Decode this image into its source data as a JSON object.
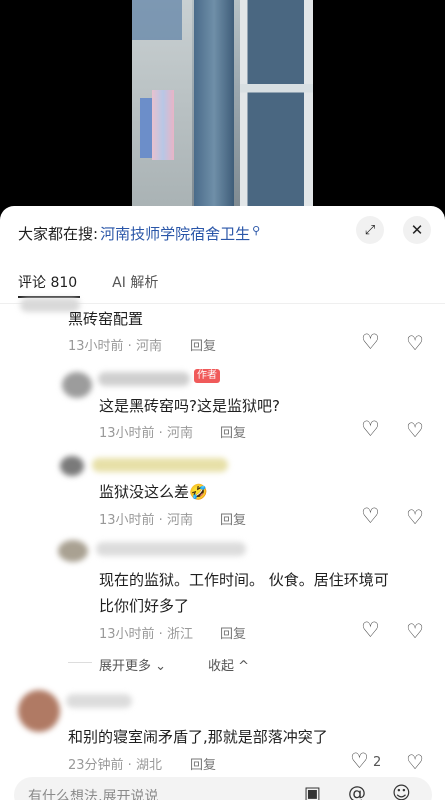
{
  "search": {
    "prefix": "大家都在搜:",
    "term": "河南技师学院宿舍卫生",
    "icon": "search-icon"
  },
  "header": {
    "expand_icon": "expand-icon",
    "close_icon": "close-icon"
  },
  "tabs": [
    {
      "label": "评论 810",
      "active": true
    },
    {
      "label": "AI 解析",
      "active": false
    }
  ],
  "comments": [
    {
      "text": "黑砖窑配置",
      "time": "13小时前 · 河南",
      "reply": "回复"
    },
    {
      "text": "这是黑砖窑吗?这是监狱吧?",
      "time": "13小时前 · 河南",
      "reply": "回复",
      "badge": "作者"
    },
    {
      "text": "监狱没这么差🤣",
      "time": "13小时前 · 河南",
      "reply": "回复"
    },
    {
      "text_line1": "现在的监狱。工作时间。 伙食。居住环境可",
      "text_line2": "比你们好多了",
      "time": "13小时前 · 浙江",
      "reply": "回复"
    },
    {
      "text": "和别的寝室闹矛盾了,那就是部落冲突了",
      "time": "23分钟前 · 湖北",
      "reply": "回复",
      "likes": "2"
    }
  ],
  "thread": {
    "expand_more": "展开更多 ⌄",
    "collapse": "收起 ^"
  },
  "input": {
    "placeholder": "有什么想法,展开说说"
  },
  "colors": {
    "link": "#2a56a8",
    "badge": "#f05a5a"
  }
}
